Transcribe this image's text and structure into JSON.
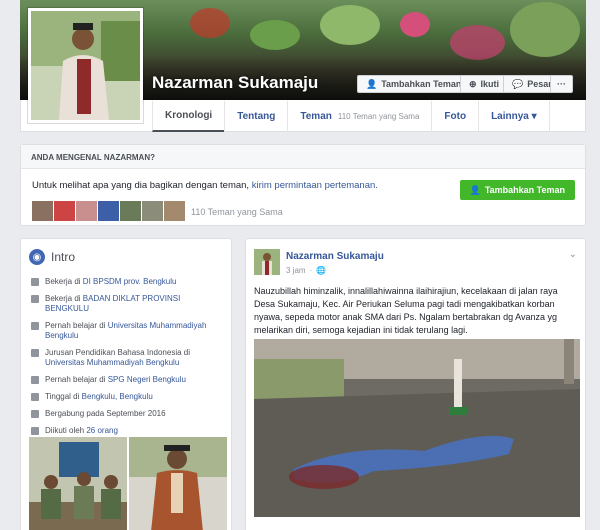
{
  "profile": {
    "name": "Nazarman Sukamaju"
  },
  "cover_buttons": {
    "add_friend": "Tambahkan Teman",
    "follow": "Ikuti",
    "message": "Pesan",
    "more": "···"
  },
  "tabs": [
    {
      "label": "Kronologi"
    },
    {
      "label": "Tentang"
    },
    {
      "label": "Teman",
      "sub": "110 Teman yang Sama"
    },
    {
      "label": "Foto"
    },
    {
      "label": "Lainnya ▾"
    }
  ],
  "know": {
    "heading": "ANDA MENGENAL NAZARMAN?",
    "message_prefix": "Untuk melihat apa yang dia bagikan dengan teman,",
    "message_link": "kirim permintaan pertemanan.",
    "add_button": "Tambahkan Teman",
    "mutual": "110 Teman yang Sama"
  },
  "intro": {
    "title": "Intro",
    "items": [
      {
        "icon": "briefcase-icon",
        "prefix": "Bekerja di ",
        "link": "DI BPSDM prov. Bengkulu"
      },
      {
        "icon": "briefcase-icon",
        "prefix": "Bekerja di ",
        "link": "BADAN DIKLAT PROVINSI BENGKULU"
      },
      {
        "icon": "graduation-cap-icon",
        "prefix": "Pernah belajar di ",
        "link": "Universitas Muhammadiyah Bengkulu"
      },
      {
        "icon": "graduation-cap-icon",
        "prefix": "Jurusan Pendidikan Bahasa Indonesia di ",
        "link": "Universitas Muhammadiyah Bengkulu"
      },
      {
        "icon": "graduation-cap-icon",
        "prefix": "Pernah belajar di ",
        "link": "SPG Negeri Bengkulu"
      },
      {
        "icon": "home-icon",
        "prefix": "Tinggal di ",
        "link": "Bengkulu, Bengkulu"
      },
      {
        "icon": "clock-icon",
        "prefix": "Bergabung pada September 2016",
        "link": ""
      },
      {
        "icon": "rss-icon",
        "prefix": "Diikuti oleh ",
        "link": "26 orang"
      }
    ]
  },
  "post": {
    "author": "Nazarman Sukamaju",
    "time": "3 jam",
    "privacy_icon": "globe-icon",
    "text": "Nauzubillah himinzalik, innalillahiwainna ilaihirajiun, kecelakaan di jalan raya Desa Sukamaju, Kec. Air Periukan Seluma pagi tadi mengakibatkan korban nyawa, sepeda motor anak SMA dari Ps. Ngalam bertabrakan dg Avanza yg melarikan diri, semoga kejadian ini tidak terulang lagi."
  }
}
